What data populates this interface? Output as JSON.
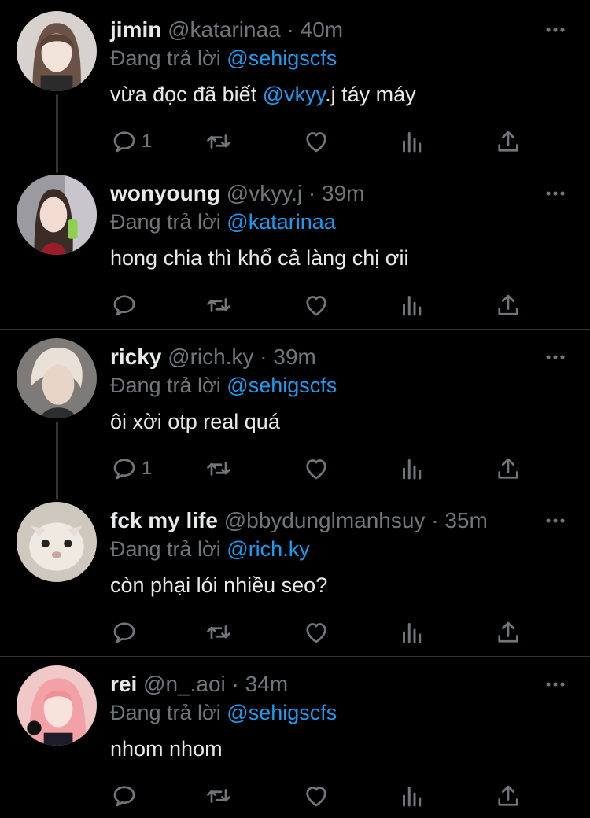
{
  "colors": {
    "background": "#000000",
    "text": "#e7e9ea",
    "muted": "#71767b",
    "mention": "#1d9bf0",
    "divider": "#2f3336"
  },
  "reply_prefix": "Đang trả lời",
  "icons": {
    "reply": "reply-icon",
    "retweet": "retweet-icon",
    "like": "heart-icon",
    "views": "views-icon",
    "share": "share-icon",
    "more": "more-icon"
  },
  "tweets": [
    {
      "name": "jimin",
      "handle": "@katarinaa",
      "time": "40m",
      "reply_to": "@sehigscfs",
      "body_parts": [
        "vừa đọc đã biết ",
        "@vkyy",
        ".j táy máy"
      ],
      "reply_count": "1"
    },
    {
      "name": "wonyoung",
      "handle": "@vkyy.j",
      "time": "39m",
      "reply_to": "@katarinaa",
      "body_parts": [
        "hong chia thì khổ cả làng chị ơii",
        "",
        ""
      ],
      "reply_count": ""
    },
    {
      "name": "ricky",
      "handle": "@rich.ky",
      "time": "39m",
      "reply_to": "@sehigscfs",
      "body_parts": [
        "ôi xời otp real quá",
        "",
        ""
      ],
      "reply_count": "1"
    },
    {
      "name": "fck my life",
      "handle": "@bbydunglmanhsuy",
      "time": "35m",
      "reply_to": "@rich.ky",
      "body_parts": [
        "còn phại lói nhiều seo?",
        "",
        ""
      ],
      "reply_count": ""
    },
    {
      "name": "rei",
      "handle": "@n_.aoi",
      "time": "34m",
      "reply_to": "@sehigscfs",
      "body_parts": [
        "nhom nhom",
        "",
        ""
      ],
      "reply_count": ""
    }
  ]
}
